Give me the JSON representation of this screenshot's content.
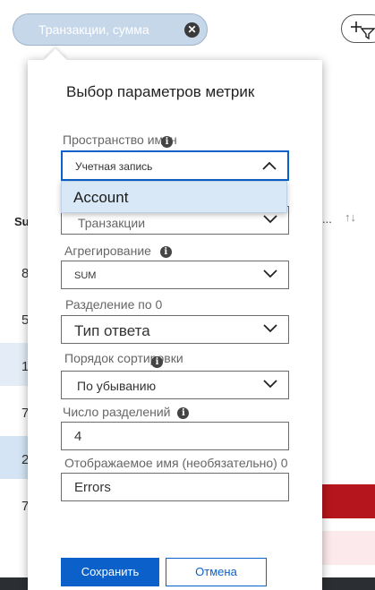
{
  "toolbar": {
    "search_placeholder": "Транзакции, сумма",
    "clear_glyph": "✕"
  },
  "background_table": {
    "header_fragment": "Su",
    "right_header_dots": "...",
    "sort_glyph": "↑↓",
    "row_digits": [
      "8",
      "5",
      "1",
      "7",
      "2",
      "7"
    ]
  },
  "dialog": {
    "title": "Выбор параметров метрик",
    "namespace": {
      "label": "Пространство имен",
      "value": "Учетная запись",
      "dropdown_option": "Account"
    },
    "metric": {
      "value": "Транзакции"
    },
    "aggregation": {
      "label": "Агрегирование",
      "value": "SUM"
    },
    "split_by": {
      "label": "Разделение по 0",
      "value": "Тип ответа"
    },
    "sort_order": {
      "label": "Порядок сортировки",
      "value": "По убыванию"
    },
    "split_count": {
      "label": "Число разделений",
      "value": "4"
    },
    "display_name": {
      "label": "Отображаемое имя (необязательно) 0",
      "value": "Errors"
    },
    "save_label": "Сохранить",
    "cancel_label": "Отмена"
  },
  "colors": {
    "accent": "#0b61c9",
    "error_bar": "#b5151d",
    "error_bar_light": "#fbe9eb",
    "pill": "#c6d7ea"
  }
}
